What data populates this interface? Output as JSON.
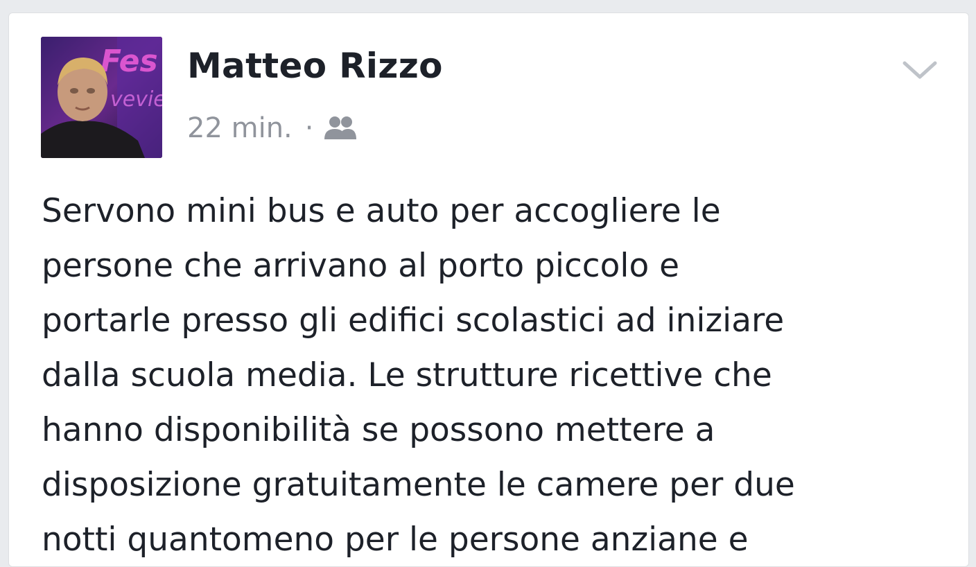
{
  "post": {
    "author": "Matteo Rizzo",
    "timestamp": "22 min.",
    "separator": "·",
    "audience_icon": "friends-icon",
    "menu_icon": "chevron-down-icon",
    "text": "Servono mini bus e auto per accogliere le\npersone che arrivano al porto piccolo e\nportarle presso gli edifici scolastici ad iniziare\ndalla scuola media. Le strutture ricettive che\nhanno disponibilità  se possono mettere a\ndisposizione gratuitamente le camere per due\nnotti quantomeno per le persone anziane e",
    "avatar_text": "Fes"
  },
  "colors": {
    "name": "#1d2129",
    "meta": "#90949c",
    "card_border": "#dddfe2",
    "background": "#e9ebee"
  }
}
